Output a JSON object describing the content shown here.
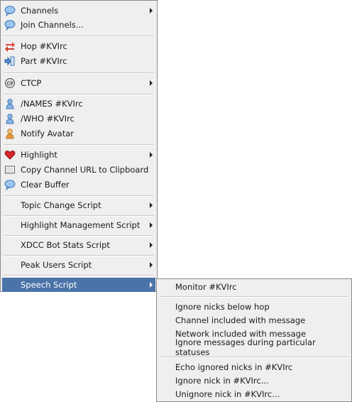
{
  "main_menu": {
    "channels": "Channels",
    "join_channels": "Join Channels...",
    "hop": "Hop #KVIrc",
    "part": "Part #KVIrc",
    "ctcp": "CTCP",
    "names": "/NAMES #KVIrc",
    "who": "/WHO #KVIrc",
    "notify_avatar": "Notify Avatar",
    "highlight": "Highlight",
    "copy_url": "Copy Channel URL to Clipboard",
    "clear_buffer": "Clear Buffer",
    "topic_change_script": "Topic Change Script",
    "highlight_management_script": "Highlight Management Script",
    "xdcc_bot_stats_script": "XDCC Bot Stats Script",
    "peak_users_script": "Peak Users Script",
    "speech_script": "Speech Script"
  },
  "speech_submenu": {
    "monitor": "Monitor #KVIrc",
    "ignore_nicks_below_hop": "Ignore nicks below hop",
    "channel_included": "Channel included with message",
    "network_included": "Network included with message",
    "ignore_statuses": "Ignore messages during particular statuses",
    "echo_ignored": "Echo ignored nicks in #KVIrc",
    "ignore_nick": "Ignore nick in #KVIrc...",
    "unignore_nick": "Unignore nick in #KVIrc..."
  },
  "colors": {
    "menu_background": "#efefef",
    "selected_background": "#4a73a8",
    "selected_text": "#ffffff"
  },
  "icons": [
    "speech-bubble-icon",
    "hop-arrows-icon",
    "part-arrow-icon",
    "ctcp-icon",
    "user-icon",
    "avatar-icon",
    "heart-icon",
    "clipboard-icon"
  ]
}
